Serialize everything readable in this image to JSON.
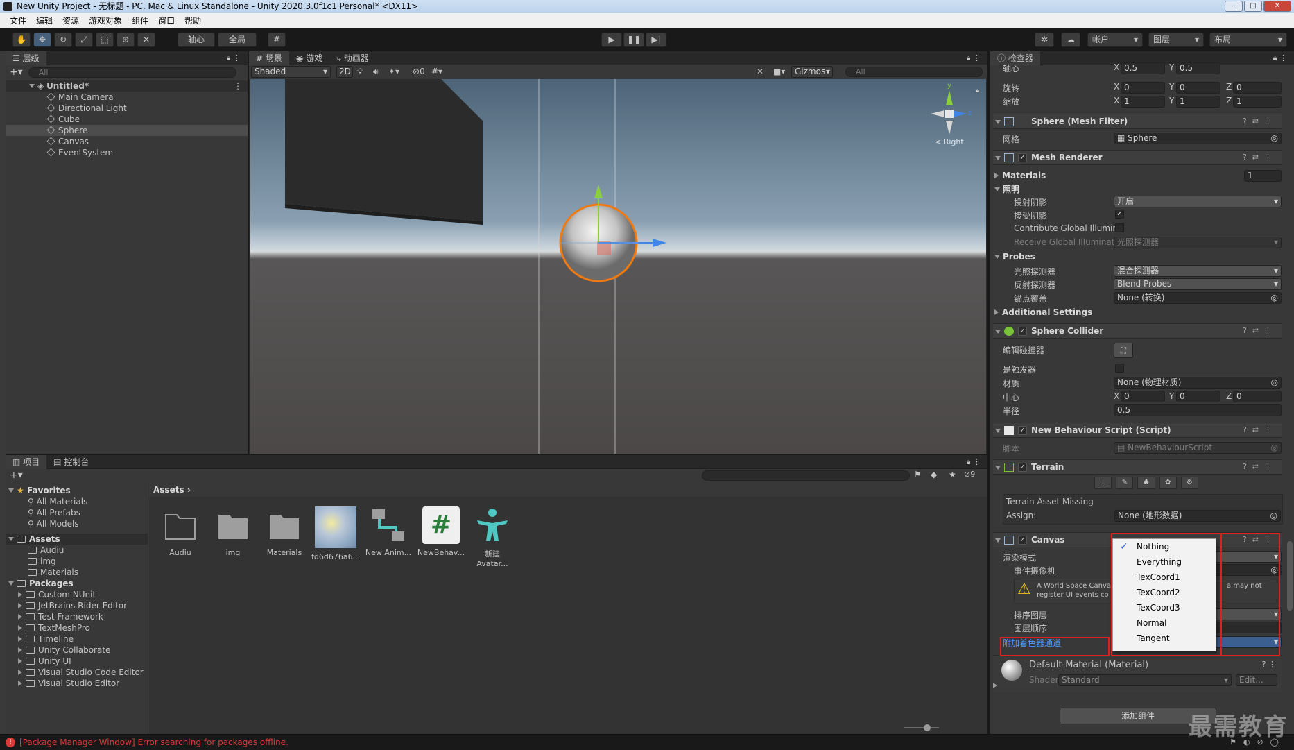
{
  "window": {
    "title": "New Unity Project - 无标题 - PC, Mac & Linux Standalone - Unity 2020.3.0f1c1 Personal* <DX11>"
  },
  "menu": [
    "文件",
    "编辑",
    "资源",
    "游戏对象",
    "组件",
    "窗口",
    "帮助"
  ],
  "toolbar": {
    "pivot": "轴心",
    "global": "全局",
    "account": "帐户",
    "layers": "图层",
    "layout": "布局"
  },
  "hierarchy": {
    "tab": "层级",
    "search_placeholder": "All",
    "scene": "Untitled*",
    "objects": [
      "Main Camera",
      "Directional Light",
      "Cube",
      "Sphere",
      "Canvas",
      "EventSystem"
    ],
    "selected": "Sphere"
  },
  "scene_view": {
    "tabs": [
      "场景",
      "游戏",
      "动画器"
    ],
    "shading": "Shaded",
    "mode_2d": "2D",
    "hidden_count": "0",
    "gizmos": "Gizmos",
    "search_placeholder": "All",
    "gizmo_labels": {
      "y": "y",
      "z": "z",
      "view": "< Right"
    }
  },
  "project": {
    "tabs": [
      "项目",
      "控制台"
    ],
    "hidden_count": "9",
    "favorites_title": "Favorites",
    "favorites": [
      "All Materials",
      "All Prefabs",
      "All Models"
    ],
    "assets_title": "Assets",
    "assets_folders": [
      "Audiu",
      "img",
      "Materials"
    ],
    "packages_title": "Packages",
    "packages": [
      "Custom NUnit",
      "JetBrains Rider Editor",
      "Test Framework",
      "TextMeshPro",
      "Timeline",
      "Unity Collaborate",
      "Unity UI",
      "Visual Studio Code Editor",
      "Visual Studio Editor"
    ],
    "breadcrumb": "Assets",
    "asset_items": [
      "Audiu",
      "img",
      "Materials",
      "fd6d676a6...",
      "New Anim...",
      "NewBehav...",
      "新建 Avatar..."
    ]
  },
  "inspector": {
    "tab": "检查器",
    "transform": {
      "pivot_label": "轴心",
      "pivot_x": "0.5",
      "pivot_y": "0.5",
      "rotation_label": "旋转",
      "rot_x": "0",
      "rot_y": "0",
      "rot_z": "0",
      "scale_label": "缩放",
      "scale_x": "1",
      "scale_y": "1",
      "scale_z": "1"
    },
    "mesh_filter": {
      "title": "Sphere (Mesh Filter)",
      "mesh_label": "网格",
      "mesh_value": "Sphere"
    },
    "mesh_renderer": {
      "title": "Mesh Renderer",
      "materials_label": "Materials",
      "materials_count": "1",
      "lighting_label": "照明",
      "cast_shadows_label": "投射阴影",
      "cast_shadows_value": "开启",
      "receive_shadows_label": "接受阴影",
      "contribute_gi_label": "Contribute Global Illumir",
      "receive_gi_label": "Receive Global Illuminati",
      "receive_gi_value": "光照探测器",
      "probes_label": "Probes",
      "light_probes_label": "光照探测器",
      "light_probes_value": "混合探测器",
      "reflection_probes_label": "反射探测器",
      "reflection_probes_value": "Blend Probes",
      "anchor_override_label": "锚点覆盖",
      "anchor_override_value": "None (转换)",
      "additional_label": "Additional Settings"
    },
    "sphere_collider": {
      "title": "Sphere Collider",
      "edit_label": "编辑碰撞器",
      "trigger_label": "是触发器",
      "material_label": "材质",
      "material_value": "None (物理材质)",
      "center_label": "中心",
      "cx": "0",
      "cy": "0",
      "cz": "0",
      "radius_label": "半径",
      "radius_value": "0.5"
    },
    "script": {
      "title": "New Behaviour Script (Script)",
      "script_label": "脚本",
      "script_value": "NewBehaviourScript"
    },
    "terrain": {
      "title": "Terrain",
      "missing": "Terrain Asset Missing",
      "assign_label": "Assign:",
      "assign_value": "None (地形数据)"
    },
    "canvas": {
      "title": "Canvas",
      "render_mode_label": "渲染模式",
      "event_camera_label": "事件摄像机",
      "warning_line1": "A World Space Canva",
      "warning_line2": "register UI events co",
      "warning_tail": "a may not",
      "sorting_layer_label": "排序图层",
      "order_label": "图层顺序",
      "shader_channels_label": "附加着色器通道"
    },
    "material": {
      "title": "Default-Material (Material)",
      "shader_label": "Shader",
      "shader_value": "Standard",
      "edit": "Edit..."
    },
    "add_component": "添加组件",
    "dropdown": {
      "options": [
        "Nothing",
        "Everything",
        "TexCoord1",
        "TexCoord2",
        "TexCoord3",
        "Normal",
        "Tangent"
      ],
      "checked": "Nothing"
    }
  },
  "status": {
    "error": "[Package Manager Window] Error searching for packages offline."
  },
  "watermark": "最需教育"
}
